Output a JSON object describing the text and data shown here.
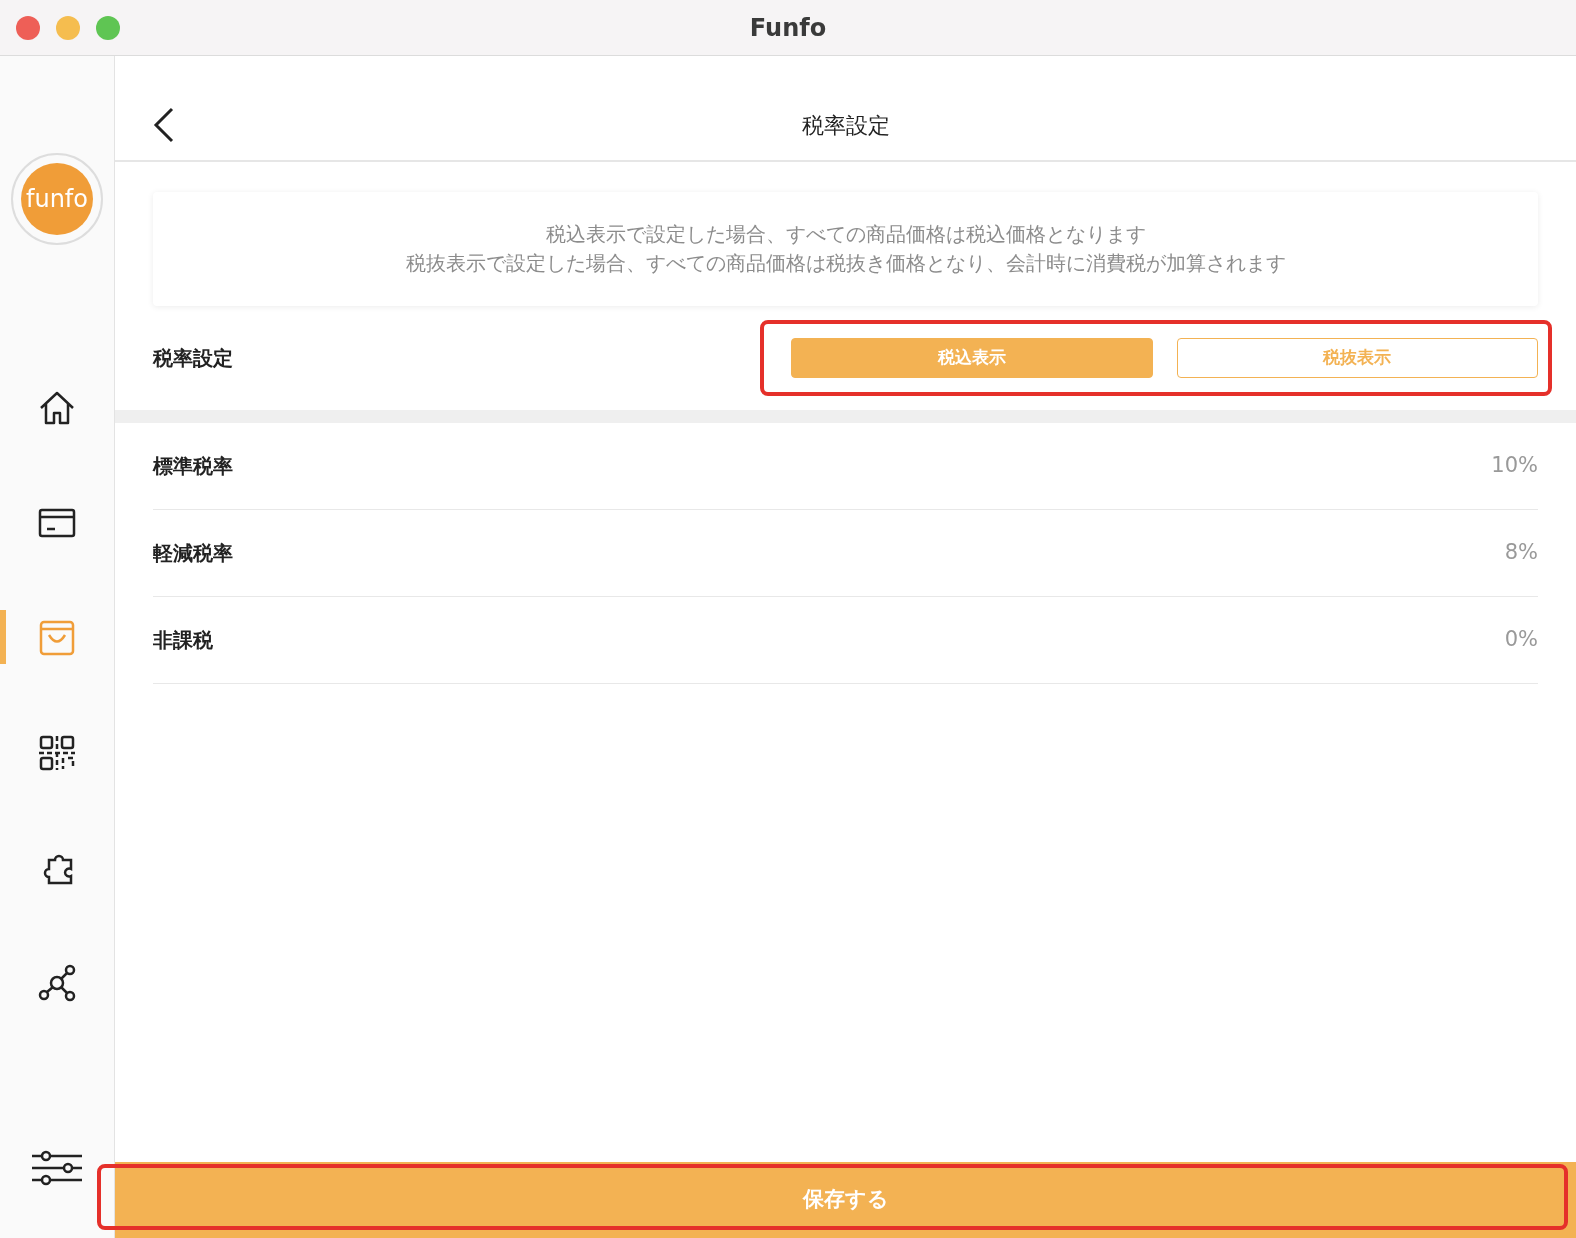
{
  "window": {
    "title": "Funfo"
  },
  "sidebar": {
    "logo": "funfo",
    "items": [
      {
        "kind": "home",
        "selected": false
      },
      {
        "kind": "card",
        "selected": false
      },
      {
        "kind": "bag",
        "selected": true
      },
      {
        "kind": "qr",
        "selected": false
      },
      {
        "kind": "puzzle",
        "selected": false
      },
      {
        "kind": "share",
        "selected": false
      }
    ],
    "settings": {
      "kind": "sliders"
    }
  },
  "header": {
    "title": "税率設定"
  },
  "notice_lines": [
    "税込表示で設定した場合、すべての商品価格は税込価格となります",
    "税抜表示で設定した場合、すべての商品価格は税抜き価格となり、会計時に消費税が加算されます"
  ],
  "tax_mode": {
    "label": "税率設定",
    "highlighted": true,
    "options": [
      {
        "label": "税込表示",
        "selected": true
      },
      {
        "label": "税抜表示",
        "selected": false
      }
    ]
  },
  "rates": [
    {
      "name": "標準税率",
      "value": "10%"
    },
    {
      "name": "軽減税率",
      "value": "8%"
    },
    {
      "name": "非課税",
      "value": "0%"
    }
  ],
  "save_button": {
    "label": "保存する",
    "highlighted": true
  }
}
